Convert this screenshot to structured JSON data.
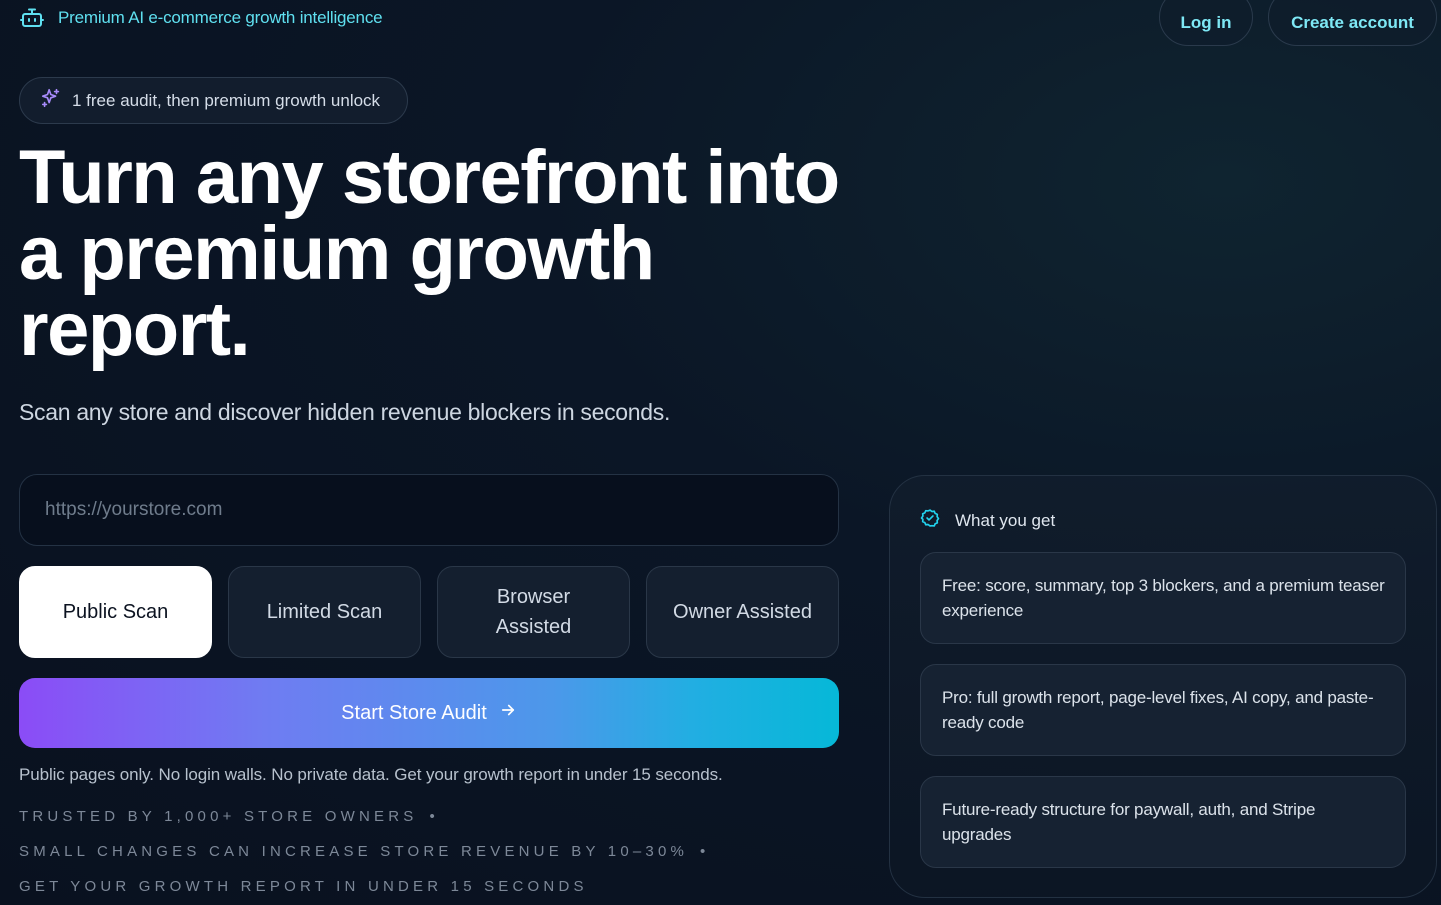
{
  "header": {
    "brand": "Premium AI e-commerce growth intelligence",
    "login": "Log in",
    "create_account": "Create account"
  },
  "badge": "1 free audit, then premium growth unlock",
  "hero": {
    "title": "Turn any storefront into a premium growth report.",
    "subtitle": "Scan any store and discover hidden revenue blockers in seconds."
  },
  "form": {
    "url_placeholder": "https://yourstore.com",
    "url_value": "",
    "scan_options": [
      "Public Scan",
      "Limited Scan",
      "Browser Assisted",
      "Owner Assisted"
    ],
    "selected_scan": "Public Scan",
    "cta": "Start Store Audit",
    "note": "Public pages only. No login walls. No private data. Get your growth report in under 15 seconds."
  },
  "trust": [
    "Trusted by 1,000+ store owners",
    "Small changes can increase store revenue by 10–30%",
    "Get your growth report in under 15 seconds"
  ],
  "card": {
    "title": "What you get",
    "benefits": [
      "Free: score, summary, top 3 blockers, and a premium teaser experience",
      "Pro: full growth report, page-level fixes, AI copy, and paste-ready code",
      "Future-ready structure for paywall, auth, and Stripe upgrades"
    ]
  },
  "colors": {
    "accent_cyan": "#5fe0f0",
    "gradient_start": "#8b4cf6",
    "gradient_end": "#06b8d8",
    "background": "#0b1626"
  },
  "icons": {
    "brand": "robot-icon",
    "badge": "sparkles-icon",
    "cta": "arrow-right-icon",
    "card": "check-circle-icon"
  }
}
